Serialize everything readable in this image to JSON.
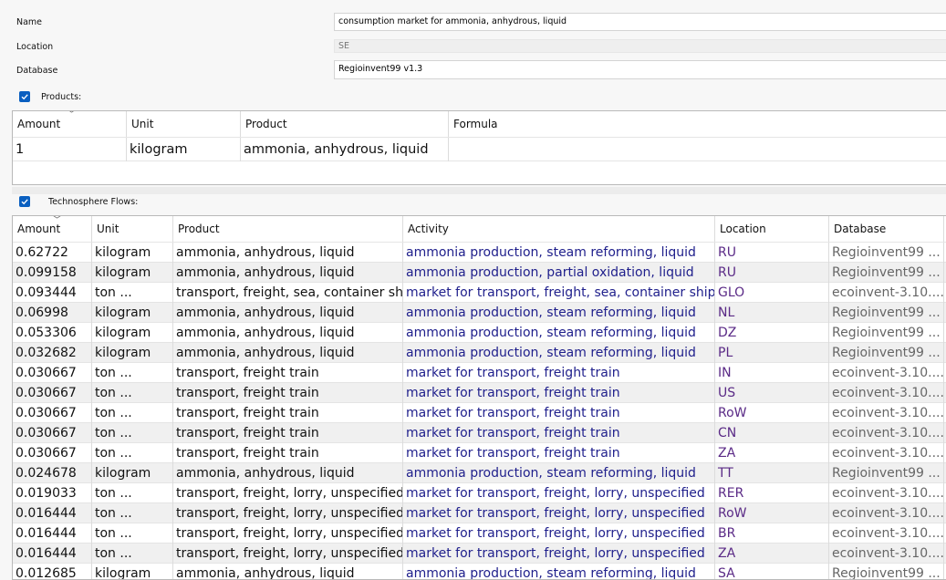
{
  "form": {
    "name_label": "Name",
    "name_value": "consumption market for ammonia, anhydrous, liquid",
    "location_label": "Location",
    "location_value": "SE",
    "database_label": "Database",
    "database_value": "Regioinvent99 v1.3"
  },
  "products": {
    "label": "Products:",
    "checked": true,
    "columns": [
      "Amount",
      "Unit",
      "Product",
      "Formula"
    ],
    "rows": [
      {
        "amount": "1",
        "unit": "kilogram",
        "product": "ammonia, anhydrous, liquid",
        "formula": ""
      }
    ]
  },
  "technosphere": {
    "label": "Technosphere Flows:",
    "checked": true,
    "columns": [
      "Amount",
      "Unit",
      "Product",
      "Activity",
      "Location",
      "Database"
    ],
    "rows": [
      {
        "amount": "0.62722",
        "unit": "kilogram",
        "product": "ammonia, anhydrous, liquid",
        "activity": "ammonia production, steam reforming, liquid",
        "location": "RU",
        "database": "Regioinvent99 ..."
      },
      {
        "amount": "0.099158",
        "unit": "kilogram",
        "product": "ammonia, anhydrous, liquid",
        "activity": "ammonia production, partial oxidation, liquid",
        "location": "RU",
        "database": "Regioinvent99 ..."
      },
      {
        "amount": "0.093444",
        "unit": "ton ...",
        "product": "transport, freight, sea, container ship",
        "activity": "market for transport, freight, sea, container ship",
        "location": "GLO",
        "database": "ecoinvent-3.10...."
      },
      {
        "amount": "0.06998",
        "unit": "kilogram",
        "product": "ammonia, anhydrous, liquid",
        "activity": "ammonia production, steam reforming, liquid",
        "location": "NL",
        "database": "Regioinvent99 ..."
      },
      {
        "amount": "0.053306",
        "unit": "kilogram",
        "product": "ammonia, anhydrous, liquid",
        "activity": "ammonia production, steam reforming, liquid",
        "location": "DZ",
        "database": "Regioinvent99 ..."
      },
      {
        "amount": "0.032682",
        "unit": "kilogram",
        "product": "ammonia, anhydrous, liquid",
        "activity": "ammonia production, steam reforming, liquid",
        "location": "PL",
        "database": "Regioinvent99 ..."
      },
      {
        "amount": "0.030667",
        "unit": "ton ...",
        "product": "transport, freight train",
        "activity": "market for transport, freight train",
        "location": "IN",
        "database": "ecoinvent-3.10...."
      },
      {
        "amount": "0.030667",
        "unit": "ton ...",
        "product": "transport, freight train",
        "activity": "market for transport, freight train",
        "location": "US",
        "database": "ecoinvent-3.10...."
      },
      {
        "amount": "0.030667",
        "unit": "ton ...",
        "product": "transport, freight train",
        "activity": "market for transport, freight train",
        "location": "RoW",
        "database": "ecoinvent-3.10...."
      },
      {
        "amount": "0.030667",
        "unit": "ton ...",
        "product": "transport, freight train",
        "activity": "market for transport, freight train",
        "location": "CN",
        "database": "ecoinvent-3.10...."
      },
      {
        "amount": "0.030667",
        "unit": "ton ...",
        "product": "transport, freight train",
        "activity": "market for transport, freight train",
        "location": "ZA",
        "database": "ecoinvent-3.10...."
      },
      {
        "amount": "0.024678",
        "unit": "kilogram",
        "product": "ammonia, anhydrous, liquid",
        "activity": "ammonia production, steam reforming, liquid",
        "location": "TT",
        "database": "Regioinvent99 ..."
      },
      {
        "amount": "0.019033",
        "unit": "ton ...",
        "product": "transport, freight, lorry, unspecified",
        "activity": "market for transport, freight, lorry, unspecified",
        "location": "RER",
        "database": "ecoinvent-3.10...."
      },
      {
        "amount": "0.016444",
        "unit": "ton ...",
        "product": "transport, freight, lorry, unspecified",
        "activity": "market for transport, freight, lorry, unspecified",
        "location": "RoW",
        "database": "ecoinvent-3.10...."
      },
      {
        "amount": "0.016444",
        "unit": "ton ...",
        "product": "transport, freight, lorry, unspecified",
        "activity": "market for transport, freight, lorry, unspecified",
        "location": "BR",
        "database": "ecoinvent-3.10...."
      },
      {
        "amount": "0.016444",
        "unit": "ton ...",
        "product": "transport, freight, lorry, unspecified",
        "activity": "market for transport, freight, lorry, unspecified",
        "location": "ZA",
        "database": "ecoinvent-3.10...."
      },
      {
        "amount": "0.012685",
        "unit": "kilogram",
        "product": "ammonia, anhydrous, liquid",
        "activity": "ammonia production, steam reforming, liquid",
        "location": "SA",
        "database": "Regioinvent99 ..."
      }
    ]
  },
  "icons": {
    "checkbox": "checkbox-checked-icon",
    "sort": "sort-chevron-down-icon"
  }
}
